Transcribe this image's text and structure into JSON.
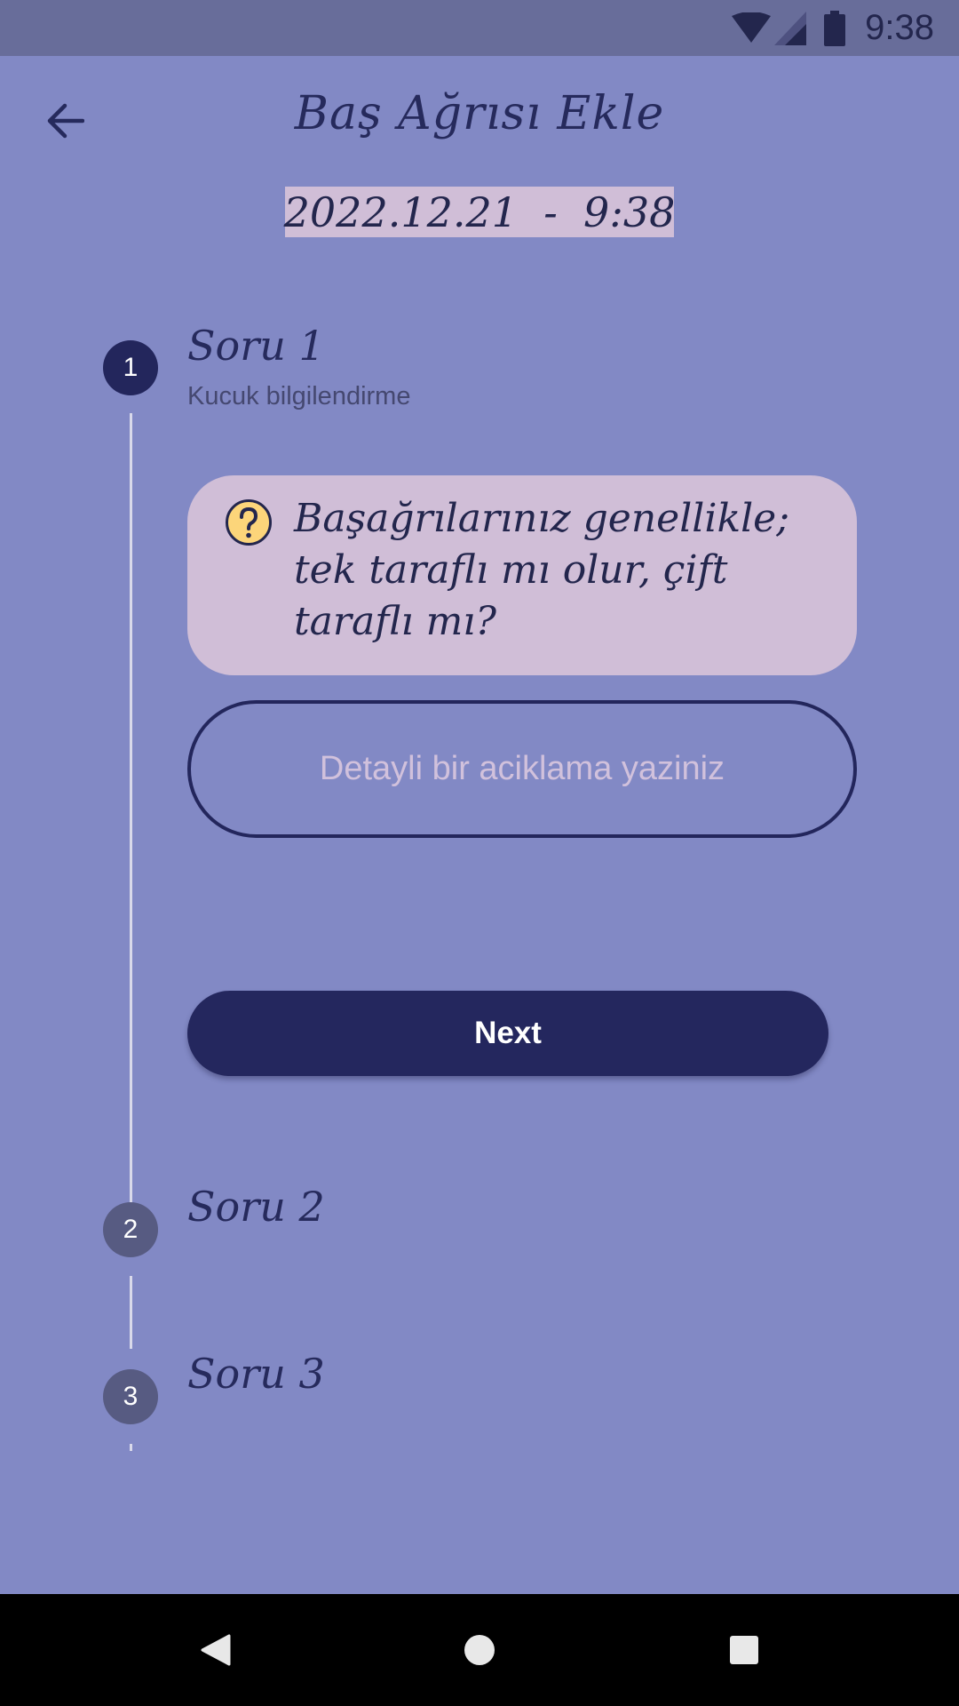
{
  "status_bar": {
    "time": "9:38",
    "icons": [
      "wifi-icon",
      "cellular-signal-icon",
      "battery-icon"
    ]
  },
  "header": {
    "back_icon": "arrow-left-icon",
    "title": "Baş Ağrısı Ekle"
  },
  "datetime": {
    "label": "2022.12.21  -  9:38"
  },
  "stepper": {
    "steps": [
      {
        "number": "1",
        "title": "Soru 1",
        "subtitle": "Kucuk bilgilendirme",
        "state": "active"
      },
      {
        "number": "2",
        "title": "Soru 2",
        "state": "inactive"
      },
      {
        "number": "3",
        "title": "Soru 3",
        "state": "inactive"
      }
    ]
  },
  "question": {
    "icon": "question-mark-icon",
    "text": "Başağrılarınız genellikle; tek taraflı mı olur, çift taraflı mı?"
  },
  "description_input": {
    "value": "",
    "placeholder": "Detayli bir aciklama yaziniz"
  },
  "actions": {
    "next_label": "Next"
  },
  "nav_bar": {
    "icons": [
      "nav-back-icon",
      "nav-home-icon",
      "nav-recents-icon"
    ]
  },
  "colors": {
    "background": "#8289c5",
    "status_bar": "#686d9a",
    "primary_dark": "#23265c",
    "card_pink": "#d0bed7",
    "inactive_step": "#575b82",
    "question_icon_fill": "#fcd57a"
  }
}
